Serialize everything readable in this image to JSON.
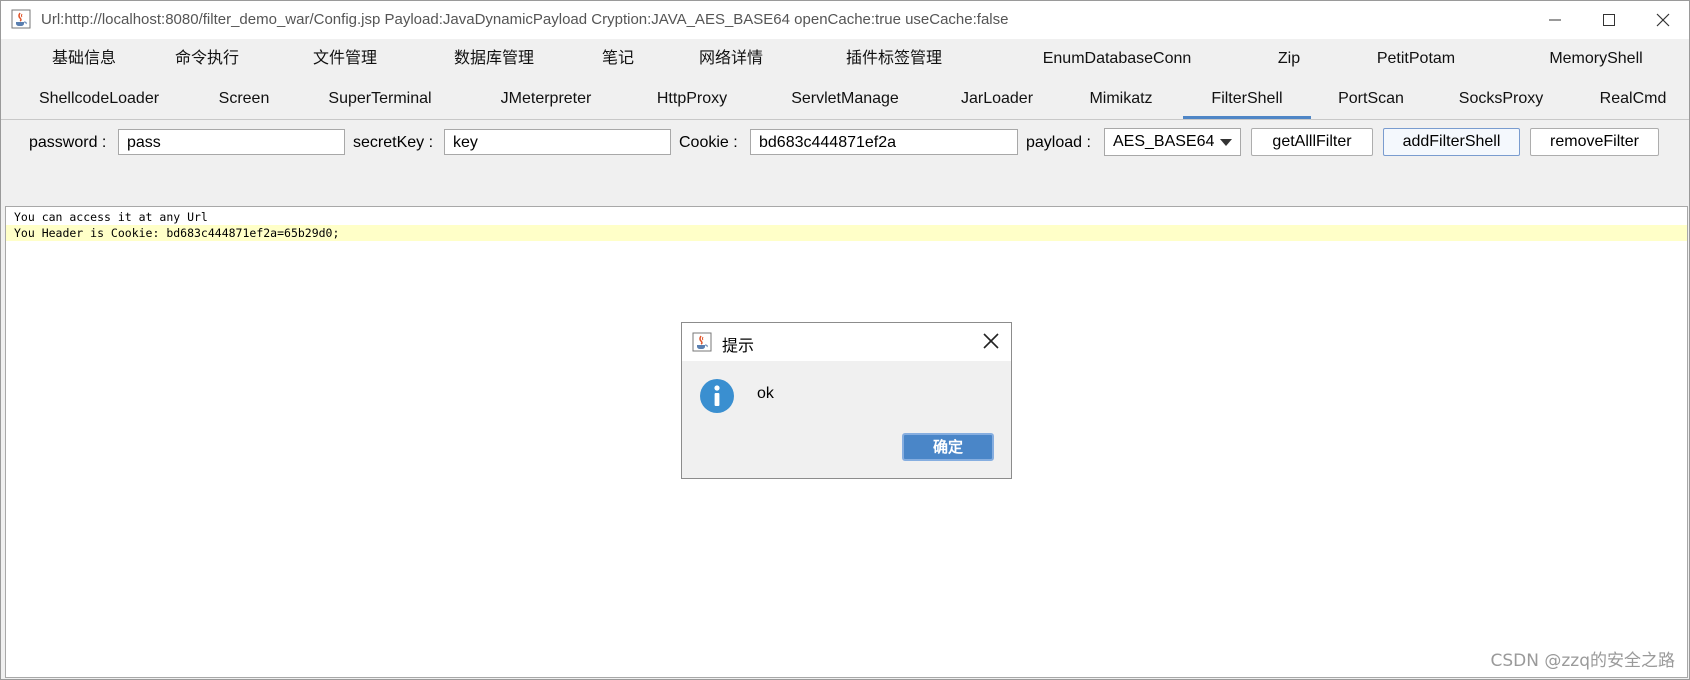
{
  "window": {
    "title": "Url:http://localhost:8080/filter_demo_war/Config.jsp Payload:JavaDynamicPayload Cryption:JAVA_AES_BASE64 openCache:true useCache:false",
    "icon": "java-cup-icon"
  },
  "tabs_row1": [
    "基础信息",
    "命令执行",
    "文件管理",
    "数据库管理",
    "笔记",
    "网络详情",
    "插件标签管理",
    "EnumDatabaseConn",
    "Zip",
    "PetitPotam",
    "MemoryShell"
  ],
  "tabs_row2": [
    "ShellcodeLoader",
    "Screen",
    "SuperTerminal",
    "JMeterpreter",
    "HttpProxy",
    "ServletManage",
    "JarLoader",
    "Mimikatz",
    "FilterShell",
    "PortScan",
    "SocksProxy",
    "RealCmd"
  ],
  "active_tab": "FilterShell",
  "controls": {
    "password_label": "password :",
    "password_value": "pass",
    "secretkey_label": "secretKey :",
    "secretkey_value": "key",
    "cookie_label": "Cookie :",
    "cookie_value": "bd683c444871ef2a",
    "payload_label": "payload :",
    "payload_value": "AES_BASE64",
    "get_all_filter": "getAlllFilter",
    "add_filter_shell": "addFilterShell",
    "remove_filter": "removeFilter"
  },
  "output": {
    "lines": [
      "You can access it at any Url",
      "You Header is Cookie: bd683c444871ef2a=65b29d0;"
    ]
  },
  "dialog": {
    "title": "提示",
    "message": "ok",
    "ok_button": "确定"
  },
  "watermark": "CSDN @zzq的安全之路",
  "colors": {
    "accent": "#4f86c6",
    "highlight": "#ffffc8",
    "info_icon": "#3a8fd0"
  }
}
